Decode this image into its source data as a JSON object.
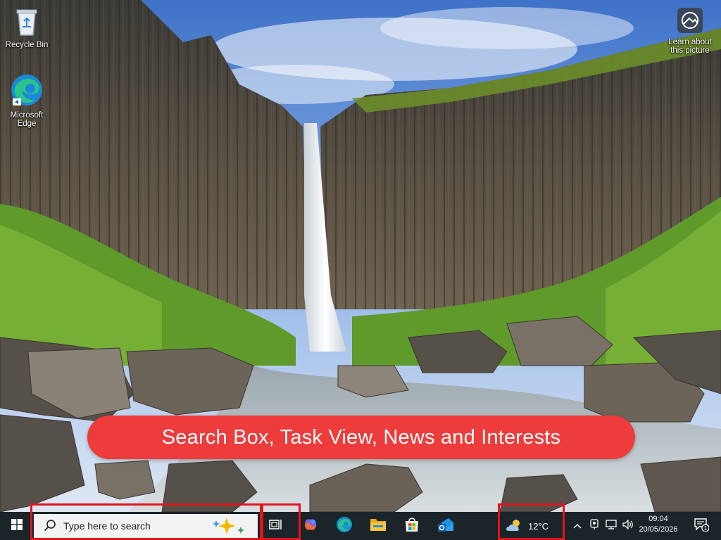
{
  "desktop": {
    "icons": [
      {
        "label": "Recycle Bin",
        "icon": "recycle-bin-icon"
      },
      {
        "label": "Microsoft Edge",
        "icon": "edge-icon"
      }
    ],
    "learn_about": {
      "label": "Learn about this picture",
      "icon": "camera-location-icon"
    }
  },
  "banner": {
    "text": "Search Box, Task View, News and Interests"
  },
  "taskbar": {
    "start_icon": "windows-start-icon",
    "search": {
      "placeholder": "Type here to search",
      "icon": "search-icon",
      "sparkle_icon": "copilot-sparkle-icon"
    },
    "task_view_icon": "task-view-icon",
    "pinned_apps": [
      {
        "name": "Copilot",
        "icon": "copilot-icon"
      },
      {
        "name": "Microsoft Edge",
        "icon": "edge-icon"
      },
      {
        "name": "File Explorer",
        "icon": "folder-icon"
      },
      {
        "name": "Microsoft Store",
        "icon": "store-icon"
      },
      {
        "name": "Outlook",
        "icon": "outlook-icon"
      }
    ],
    "weather": {
      "temp": "12°C",
      "icon": "partly-cloudy-icon"
    },
    "tray_icons": [
      "chevron-up-icon",
      "meet-now-icon",
      "network-icon",
      "volume-icon"
    ],
    "clock": {
      "time": "09:04",
      "date": "20/05/2026"
    },
    "notifications": {
      "count": "1",
      "icon": "notification-icon"
    }
  },
  "colors": {
    "highlight": "#e0151c",
    "banner": "#ee3b3b",
    "taskbar": "#1b2428"
  }
}
